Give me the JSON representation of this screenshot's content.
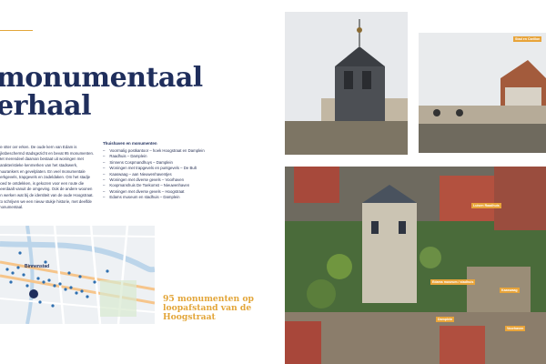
{
  "page": {
    "title_lines": [
      "monumentaal",
      "erhaal"
    ],
    "intro": "de stter ovr erken. De oude kern van Edam is rijksbeschermd stadsgezicht en bevat 95 monumenten. Het merendeel daarvan bestaat uit woningen met karakteristieke kenmerken van het stadswerk, muurankers en gevelplaten. En veel monumentale kerkgevels, trapgevels en zadeldaken. Om het stadje goed te ontdekken, is gekozen voor een route die neerdaalt vanuit de omgeving. Ook de andere woonen en werken wat bij de identiteit van de oude Hoogstraat. Zo schrijven we een nieuw stukje historie, met deelfde monumentaal.",
    "list_heading": "Thuishaven en monumenten",
    "monuments": [
      "Voormalig postkantoor – hoek Hoogstraat en Damplein",
      "Raadhuis – Damplein",
      "Sinnens Cospmandhuys – Damplein",
      "Woningen met trapgevels en puntgevels – De Bult",
      "Kaaswaag – aan Nieuwenhaventjes",
      "Woningen met diverse gevels – Voorhaven",
      "Koopmanshuis De Toekomst – Nieuwenhaven",
      "Woningen met diverse gevels – Hoogstraat",
      "Edams museum en stadhuis – Damplein"
    ],
    "map_label": "Binnenstad",
    "caption_lines": [
      "95 monumenten op",
      "loopafstand van de",
      "Hoogstraat"
    ],
    "photo_labels": {
      "tr": "Stad en Carillon",
      "a": "Luisen Raadhuis",
      "b": "Edams museum / stadhuis",
      "c": "Kaaswaag",
      "d": "Damplein",
      "e": "Voorhaven"
    }
  },
  "colors": {
    "navy": "#1f2e5c",
    "gold": "#e3a63a",
    "label_bg": "#e8a43a"
  }
}
